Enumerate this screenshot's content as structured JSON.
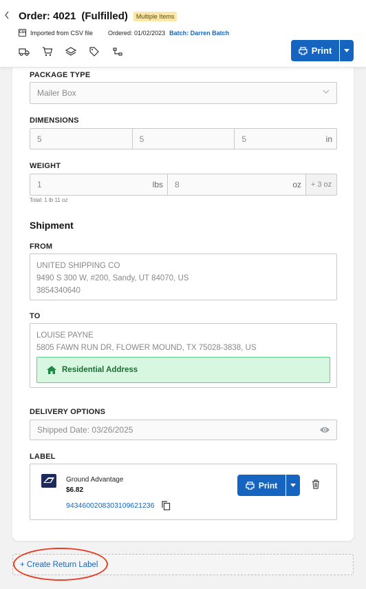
{
  "header": {
    "order_title": "Order: 4021",
    "status": "(Fulfilled)",
    "badge": "Multiple Items",
    "import_source": "Imported from CSV file",
    "ordered": "Ordered: 01/02/2023",
    "batch": "Batch: Darren Batch",
    "print_label": "Print",
    "csv_icon_text": "CSV",
    "toolbar_icons": [
      "truck-icon",
      "cart-icon",
      "layers-icon",
      "tag-icon",
      "timeline-icon"
    ]
  },
  "package": {
    "type_label": "PACKAGE TYPE",
    "type_value": "Mailer Box",
    "dimensions_label": "DIMENSIONS",
    "dimensions": [
      "5",
      "5",
      "5"
    ],
    "dimension_unit": "in",
    "weight_label": "WEIGHT",
    "weight_lbs": "1",
    "weight_lbs_unit": "lbs",
    "weight_oz": "8",
    "weight_oz_unit": "oz",
    "weight_extra": "+ 3 oz",
    "total": "Total: 1 lb 11 oz"
  },
  "shipment": {
    "heading": "Shipment",
    "from_label": "FROM",
    "from_name": "UNITED SHIPPING CO",
    "from_address": "9490 S 300 W, #200, Sandy, UT 84070, US",
    "from_phone": "3854340640",
    "to_label": "TO",
    "to_name": "LOUISE PAYNE",
    "to_address": "5805 FAWN RUN DR, FLOWER MOUND, TX 75028-3838, US",
    "residential": "Residential Address"
  },
  "delivery": {
    "label": "DELIVERY OPTIONS",
    "shipped_date": "Shipped Date: 03/26/2025"
  },
  "label": {
    "label": "LABEL",
    "service": "Ground Advantage",
    "price": "$6.82",
    "tracking": "9434600208303109621236",
    "print_label": "Print"
  },
  "return_label": "+ Create Return Label",
  "colors": {
    "accent": "#1565c0",
    "badge": "#fbe7a6",
    "residential_bg": "#d7f7e1",
    "annotation": "#e53e24"
  }
}
